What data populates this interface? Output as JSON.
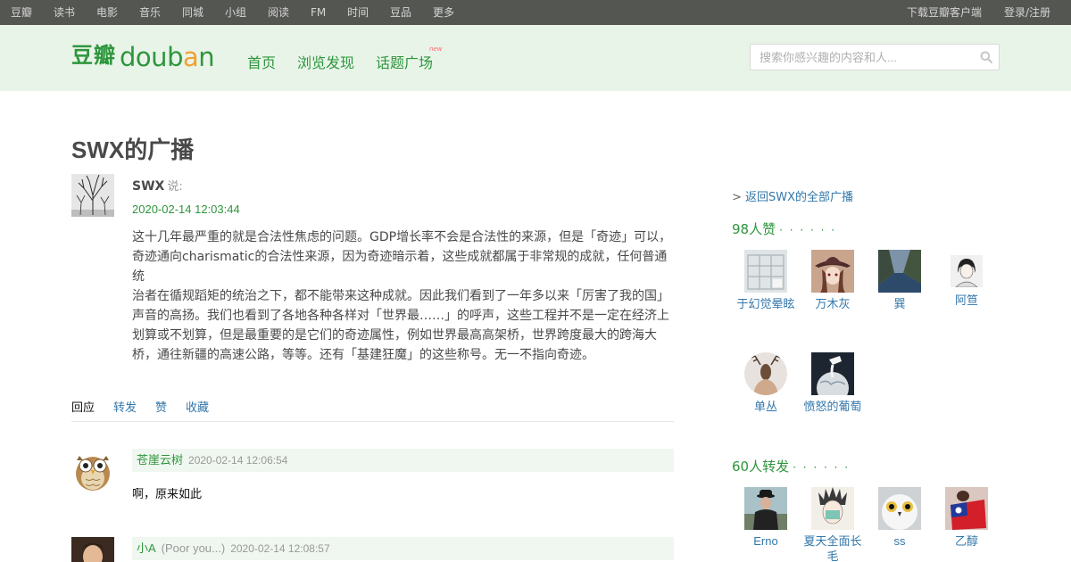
{
  "global_nav": {
    "left": [
      "豆瓣",
      "读书",
      "电影",
      "音乐",
      "同城",
      "小组",
      "阅读",
      "FM",
      "时间",
      "豆品",
      "更多"
    ],
    "download": "下载豆瓣客户端",
    "login": "登录/注册"
  },
  "header": {
    "logo_cn": "豆瓣",
    "logo_en": "douban",
    "nav": [
      "首页",
      "浏览发现",
      "话题广场"
    ],
    "new_badge": "new",
    "search_placeholder": "搜索你感兴趣的内容和人..."
  },
  "colors": {
    "brand_green": "#2e963d",
    "link_blue": "#3377aa",
    "header_bg": "#e9f4e9",
    "topbar_bg": "#545652"
  },
  "post": {
    "page_title": "SWX的广播",
    "author": "SWX",
    "says": "说:",
    "time": "2020-02-14 12:03:44",
    "lines": [
      "这十几年最严重的就是合法性焦虑的问题。GDP增长率不会是合法性的来源，但是「奇迹」可以，",
      "奇迹通向charismatic的合法性来源，因为奇迹暗示着，这些成就都属于非常规的成就，任何普通统",
      "治者在循规蹈矩的统治之下，都不能带来这种成就。因此我们看到了一年多以来「厉害了我的国」",
      "声音的高扬。我们也看到了各地各种各样对「世界最……」的呼声，这些工程并不是一定在经济上",
      "划算或不划算，但是最重要的是它们的奇迹属性，例如世界最高高架桥，世界跨度最大的跨海大",
      "桥，通往新疆的高速公路，等等。还有「基建狂魔」的这些称号。无一不指向奇迹。"
    ]
  },
  "actions": [
    "回应",
    "转发",
    "赞",
    "收藏"
  ],
  "comments": [
    {
      "name": "苍崖云树",
      "signature": "",
      "time": "2020-02-14 12:06:54",
      "text": "啊，原来如此",
      "avatar_icon": "owl-avatar"
    },
    {
      "name": "小A",
      "signature": "(Poor you...)",
      "time": "2020-02-14 12:08:57",
      "text": "",
      "avatar_icon": "napoleon-avatar"
    }
  ],
  "sidebar": {
    "back_prefix": ">",
    "back_link": "返回SWX的全部广播",
    "likes_heading": "98人赞",
    "likes_more": "· · · · · ·",
    "likers": [
      "于幻觉晕眩",
      "万木灰",
      "巽",
      "阿笪",
      "单丛",
      "愤怒的葡萄"
    ],
    "reshares_heading": "60人转发",
    "reshares_more": "· · · · · ·",
    "resharers": [
      "Erno",
      "夏天全面长毛",
      "ss",
      "乙醇"
    ]
  }
}
